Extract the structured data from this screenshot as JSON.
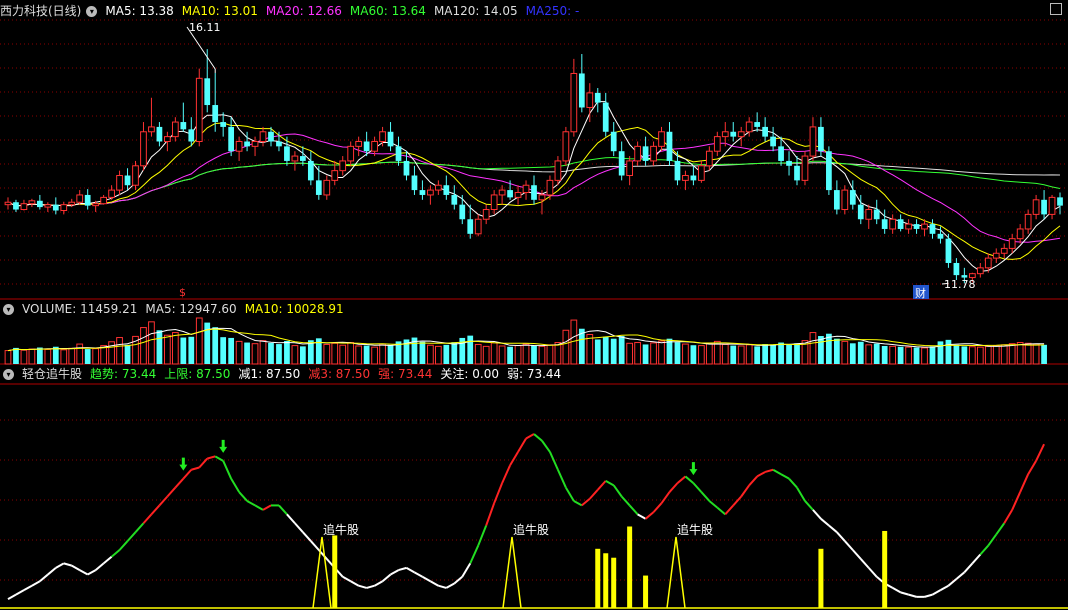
{
  "stock": {
    "title": "西力科技(日线)"
  },
  "ma_legend": [
    {
      "label": "MA5: 13.38",
      "color": "#ffffff"
    },
    {
      "label": "MA10: 13.01",
      "color": "#ffff00"
    },
    {
      "label": "MA20: 12.66",
      "color": "#ff33ff"
    },
    {
      "label": "MA60: 13.64",
      "color": "#33ff33"
    },
    {
      "label": "MA120: 14.05",
      "color": "#dddddd"
    },
    {
      "label": "MA250: -",
      "color": "#3333ff"
    }
  ],
  "price_annotations": {
    "high": "16.11",
    "low": "11.78",
    "low_badge": "财",
    "event_marker": "$"
  },
  "volume_legend": [
    {
      "label": "VOLUME: 11459.21",
      "color": "#dddddd"
    },
    {
      "label": "MA5: 12947.60",
      "color": "#dddddd"
    },
    {
      "label": "MA10: 10028.91",
      "color": "#ffff00"
    }
  ],
  "indicator_title": "轻仓追牛股",
  "indicator_legend": [
    {
      "label": "趋势: 73.44",
      "color": "#33ff33"
    },
    {
      "label": "上限: 87.50",
      "color": "#33ff33"
    },
    {
      "label": "减1: 87.50",
      "color": "#ffffff"
    },
    {
      "label": "减3: 87.50",
      "color": "#ff3333"
    },
    {
      "label": "强: 73.44",
      "color": "#ff3333"
    },
    {
      "label": "关注: 0.00",
      "color": "#ffffff"
    },
    {
      "label": "弱: 73.44",
      "color": "#ffffff"
    }
  ],
  "signal_label": "追牛股",
  "colors": {
    "up": "#ff3232",
    "down": "#54ffff",
    "grid": "#8b0000",
    "volume_ma5": "#ffffff",
    "volume_ma10": "#ffff00"
  },
  "chart_data": {
    "type": "candlestick",
    "price_range": [
      11.5,
      17.2
    ],
    "candles": [
      [
        13.4,
        13.55,
        13.3,
        13.45
      ],
      [
        13.45,
        13.5,
        13.25,
        13.3
      ],
      [
        13.3,
        13.5,
        13.28,
        13.42
      ],
      [
        13.42,
        13.52,
        13.35,
        13.48
      ],
      [
        13.48,
        13.6,
        13.3,
        13.35
      ],
      [
        13.35,
        13.45,
        13.25,
        13.4
      ],
      [
        13.4,
        13.55,
        13.2,
        13.28
      ],
      [
        13.28,
        13.46,
        13.2,
        13.4
      ],
      [
        13.4,
        13.52,
        13.35,
        13.45
      ],
      [
        13.45,
        13.7,
        13.4,
        13.6
      ],
      [
        13.6,
        13.72,
        13.3,
        13.38
      ],
      [
        13.38,
        13.48,
        13.25,
        13.42
      ],
      [
        13.42,
        13.6,
        13.4,
        13.55
      ],
      [
        13.55,
        13.8,
        13.5,
        13.7
      ],
      [
        13.7,
        14.1,
        13.6,
        14.0
      ],
      [
        14.0,
        14.15,
        13.7,
        13.8
      ],
      [
        13.8,
        14.3,
        13.7,
        14.2
      ],
      [
        14.2,
        15.1,
        14.1,
        14.9
      ],
      [
        14.9,
        15.6,
        14.8,
        15.0
      ],
      [
        15.0,
        15.1,
        14.6,
        14.7
      ],
      [
        14.7,
        14.9,
        14.5,
        14.8
      ],
      [
        14.8,
        15.2,
        14.7,
        15.1
      ],
      [
        15.1,
        15.5,
        14.9,
        14.95
      ],
      [
        14.95,
        15.2,
        14.6,
        14.7
      ],
      [
        14.7,
        16.2,
        14.6,
        16.0
      ],
      [
        16.0,
        16.6,
        15.3,
        15.45
      ],
      [
        15.45,
        16.11,
        14.9,
        15.1
      ],
      [
        15.1,
        15.3,
        14.8,
        15.0
      ],
      [
        15.0,
        15.2,
        14.4,
        14.5
      ],
      [
        14.5,
        14.8,
        14.3,
        14.7
      ],
      [
        14.7,
        14.9,
        14.5,
        14.6
      ],
      [
        14.6,
        14.8,
        14.4,
        14.7
      ],
      [
        14.7,
        15.0,
        14.6,
        14.9
      ],
      [
        14.9,
        15.0,
        14.6,
        14.7
      ],
      [
        14.7,
        14.9,
        14.5,
        14.6
      ],
      [
        14.6,
        14.8,
        14.2,
        14.3
      ],
      [
        14.3,
        14.5,
        14.1,
        14.4
      ],
      [
        14.4,
        14.6,
        14.2,
        14.3
      ],
      [
        14.3,
        14.5,
        13.8,
        13.9
      ],
      [
        13.9,
        14.2,
        13.5,
        13.6
      ],
      [
        13.6,
        14.0,
        13.5,
        13.9
      ],
      [
        13.9,
        14.3,
        13.8,
        14.1
      ],
      [
        14.1,
        14.4,
        14.0,
        14.3
      ],
      [
        14.3,
        14.7,
        14.2,
        14.6
      ],
      [
        14.6,
        14.8,
        14.4,
        14.7
      ],
      [
        14.7,
        14.9,
        14.4,
        14.5
      ],
      [
        14.5,
        14.8,
        14.4,
        14.7
      ],
      [
        14.7,
        15.0,
        14.6,
        14.9
      ],
      [
        14.9,
        15.1,
        14.5,
        14.6
      ],
      [
        14.6,
        14.8,
        14.2,
        14.3
      ],
      [
        14.3,
        14.5,
        13.9,
        14.0
      ],
      [
        14.0,
        14.2,
        13.6,
        13.7
      ],
      [
        13.7,
        13.9,
        13.5,
        13.6
      ],
      [
        13.6,
        13.8,
        13.4,
        13.7
      ],
      [
        13.7,
        13.9,
        13.6,
        13.8
      ],
      [
        13.8,
        14.0,
        13.5,
        13.6
      ],
      [
        13.6,
        13.8,
        13.3,
        13.4
      ],
      [
        13.4,
        13.6,
        13.0,
        13.1
      ],
      [
        13.1,
        13.4,
        12.7,
        12.8
      ],
      [
        12.8,
        13.2,
        12.75,
        13.1
      ],
      [
        13.1,
        13.4,
        13.0,
        13.3
      ],
      [
        13.3,
        13.7,
        13.2,
        13.6
      ],
      [
        13.6,
        13.8,
        13.4,
        13.7
      ],
      [
        13.7,
        13.9,
        13.5,
        13.55
      ],
      [
        13.55,
        13.8,
        13.4,
        13.65
      ],
      [
        13.65,
        13.9,
        13.5,
        13.8
      ],
      [
        13.8,
        14.0,
        13.4,
        13.5
      ],
      [
        13.5,
        13.7,
        13.2,
        13.6
      ],
      [
        13.6,
        14.0,
        13.5,
        13.9
      ],
      [
        13.9,
        14.4,
        13.8,
        14.3
      ],
      [
        14.3,
        15.0,
        14.2,
        14.9
      ],
      [
        14.9,
        16.4,
        14.8,
        16.1
      ],
      [
        16.1,
        16.5,
        15.3,
        15.4
      ],
      [
        15.4,
        15.9,
        15.1,
        15.7
      ],
      [
        15.7,
        15.8,
        15.3,
        15.5
      ],
      [
        15.5,
        15.7,
        14.8,
        14.9
      ],
      [
        14.9,
        15.1,
        14.4,
        14.5
      ],
      [
        14.5,
        14.7,
        13.9,
        14.0
      ],
      [
        14.0,
        14.4,
        13.8,
        14.3
      ],
      [
        14.3,
        14.7,
        14.2,
        14.6
      ],
      [
        14.6,
        14.8,
        14.2,
        14.3
      ],
      [
        14.3,
        14.7,
        14.2,
        14.6
      ],
      [
        14.6,
        15.0,
        14.5,
        14.9
      ],
      [
        14.9,
        15.1,
        14.2,
        14.3
      ],
      [
        14.3,
        14.5,
        13.8,
        13.9
      ],
      [
        13.9,
        14.1,
        13.7,
        14.0
      ],
      [
        14.0,
        14.2,
        13.8,
        13.9
      ],
      [
        13.9,
        14.3,
        13.85,
        14.2
      ],
      [
        14.2,
        14.6,
        14.1,
        14.5
      ],
      [
        14.5,
        14.9,
        14.4,
        14.8
      ],
      [
        14.8,
        15.1,
        14.6,
        14.9
      ],
      [
        14.9,
        15.1,
        14.7,
        14.8
      ],
      [
        14.8,
        15.0,
        14.6,
        14.9
      ],
      [
        14.9,
        15.2,
        14.8,
        15.1
      ],
      [
        15.1,
        15.3,
        14.9,
        15.0
      ],
      [
        15.0,
        15.2,
        14.7,
        14.8
      ],
      [
        14.8,
        15.0,
        14.5,
        14.6
      ],
      [
        14.6,
        14.8,
        14.2,
        14.3
      ],
      [
        14.3,
        14.5,
        14.0,
        14.2
      ],
      [
        14.2,
        14.4,
        13.8,
        13.9
      ],
      [
        13.9,
        14.5,
        13.8,
        14.4
      ],
      [
        14.4,
        15.2,
        14.3,
        15.0
      ],
      [
        15.0,
        15.2,
        14.4,
        14.5
      ],
      [
        14.5,
        14.6,
        13.6,
        13.7
      ],
      [
        13.7,
        13.9,
        13.2,
        13.3
      ],
      [
        13.3,
        13.8,
        13.2,
        13.7
      ],
      [
        13.7,
        13.9,
        13.3,
        13.4
      ],
      [
        13.4,
        13.6,
        13.0,
        13.1
      ],
      [
        13.1,
        13.4,
        12.9,
        13.3
      ],
      [
        13.3,
        13.5,
        13.0,
        13.1
      ],
      [
        13.1,
        13.3,
        12.8,
        12.9
      ],
      [
        12.9,
        13.2,
        12.8,
        13.1
      ],
      [
        13.1,
        13.2,
        12.85,
        12.9
      ],
      [
        12.9,
        13.1,
        12.8,
        13.0
      ],
      [
        13.0,
        13.1,
        12.8,
        12.9
      ],
      [
        12.9,
        13.1,
        12.75,
        13.0
      ],
      [
        13.0,
        13.1,
        12.7,
        12.8
      ],
      [
        12.8,
        12.95,
        12.6,
        12.7
      ],
      [
        12.7,
        12.8,
        12.1,
        12.2
      ],
      [
        12.2,
        12.3,
        11.85,
        11.95
      ],
      [
        11.95,
        12.1,
        11.78,
        11.9
      ],
      [
        11.9,
        12.0,
        11.8,
        11.98
      ],
      [
        11.98,
        12.2,
        11.9,
        12.1
      ],
      [
        12.1,
        12.4,
        12.0,
        12.3
      ],
      [
        12.3,
        12.5,
        12.2,
        12.4
      ],
      [
        12.4,
        12.6,
        12.3,
        12.5
      ],
      [
        12.5,
        12.8,
        12.4,
        12.7
      ],
      [
        12.7,
        13.0,
        12.6,
        12.9
      ],
      [
        12.9,
        13.3,
        12.8,
        13.2
      ],
      [
        13.2,
        13.6,
        13.1,
        13.5
      ],
      [
        13.5,
        13.7,
        13.1,
        13.2
      ],
      [
        13.2,
        13.6,
        13.1,
        13.55
      ],
      [
        13.55,
        13.65,
        13.2,
        13.38
      ]
    ],
    "volume_range": [
      0,
      12000
    ],
    "volumes": [
      3500,
      4200,
      3600,
      3900,
      4300,
      3800,
      4500,
      3700,
      4100,
      5200,
      3900,
      4000,
      4800,
      5800,
      6900,
      5000,
      7200,
      9500,
      11000,
      8800,
      7500,
      8200,
      6900,
      7100,
      12000,
      10800,
      9600,
      7000,
      6800,
      5900,
      5600,
      5300,
      6100,
      5500,
      5200,
      6000,
      4800,
      4600,
      6200,
      6700,
      5100,
      5400,
      4900,
      5600,
      4700,
      4800,
      4400,
      5200,
      5000,
      5900,
      6400,
      6900,
      5800,
      4900,
      4600,
      5000,
      5700,
      6800,
      7400,
      5100,
      4600,
      5500,
      4700,
      4500,
      4800,
      5200,
      4900,
      4600,
      5000,
      5600,
      8800,
      11459,
      9200,
      7700,
      6400,
      7100,
      6600,
      7300,
      5400,
      5600,
      5100,
      5500,
      6000,
      6600,
      5700,
      5200,
      4900,
      4800,
      5300,
      5900,
      5100,
      4800,
      4700,
      5000,
      4600,
      5200,
      5100,
      5600,
      5000,
      5400,
      6100,
      8200,
      7300,
      7900,
      6600,
      5900,
      5400,
      5800,
      5000,
      5300,
      4700,
      4600,
      4500,
      4400,
      4300,
      4200,
      4600,
      5900,
      6300,
      5000,
      4600,
      4500,
      4400,
      4600,
      4800,
      5000,
      5300,
      5600,
      5400,
      5200,
      5000
    ],
    "indicator_range": [
      0,
      100
    ],
    "indicator": [
      4,
      6,
      8,
      10,
      12,
      15,
      18,
      20,
      19,
      17,
      15,
      17,
      20,
      23,
      26,
      30,
      34,
      38,
      42,
      46,
      50,
      54,
      58,
      62,
      63,
      67,
      68,
      66,
      58,
      52,
      48,
      46,
      44,
      46,
      46,
      42,
      38,
      34,
      30,
      26,
      22,
      18,
      14,
      12,
      10,
      9,
      10,
      12,
      15,
      17,
      18,
      16,
      14,
      12,
      10,
      9,
      11,
      14,
      20,
      28,
      37,
      47,
      56,
      64,
      70,
      76,
      78,
      75,
      70,
      62,
      54,
      48,
      46,
      49,
      53,
      57,
      55,
      50,
      46,
      42,
      40,
      43,
      47,
      52,
      56,
      59,
      56,
      52,
      48,
      45,
      42,
      46,
      50,
      55,
      59,
      61,
      62,
      60,
      58,
      54,
      48,
      44,
      40,
      37,
      34,
      30,
      26,
      22,
      18,
      14,
      11,
      9,
      7,
      6,
      5,
      5,
      6,
      8,
      10,
      13,
      16,
      20,
      24,
      28,
      33,
      38,
      44,
      52,
      60,
      66,
      73.44
    ],
    "signals": [
      {
        "index": 41,
        "height": 46
      },
      {
        "index": 74,
        "height": 40
      },
      {
        "index": 75,
        "height": 38
      },
      {
        "index": 76,
        "height": 36
      },
      {
        "index": 78,
        "height": 50
      },
      {
        "index": 80,
        "height": 28
      },
      {
        "index": 102,
        "height": 40
      },
      {
        "index": 110,
        "height": 48
      }
    ],
    "arrows": [
      22,
      27,
      86
    ]
  }
}
